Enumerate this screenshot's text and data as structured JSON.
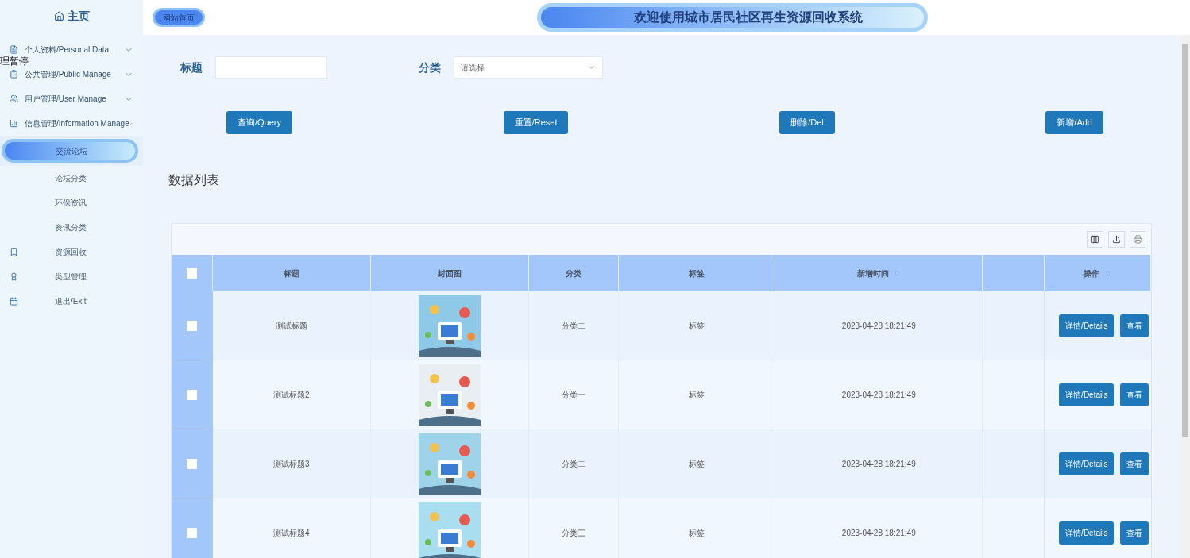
{
  "sidebar": {
    "home": "主页",
    "overlay_text": "理暂停",
    "groups": [
      {
        "label": "个人资料/Personal Data",
        "expanded": false
      },
      {
        "label": "公共管理/Public Manage",
        "expanded": false
      },
      {
        "label": "用户管理/User Manage",
        "expanded": false
      },
      {
        "label": "信息管理/Information Manage",
        "expanded": true,
        "children": [
          {
            "label": "交流论坛",
            "selected": true
          },
          {
            "label": "论坛分类",
            "selected": false
          },
          {
            "label": "环保资讯",
            "selected": false
          },
          {
            "label": "资讯分类",
            "selected": false
          }
        ]
      }
    ],
    "items": [
      {
        "label": "资源回收"
      },
      {
        "label": "类型管理"
      },
      {
        "label": "退出/Exit"
      }
    ]
  },
  "header": {
    "home_link": "网站首页",
    "title": "欢迎使用城市居民社区再生资源回收系统"
  },
  "search": {
    "fields": [
      {
        "label": "标题",
        "kind": "text"
      },
      {
        "label": "分类",
        "kind": "select",
        "placeholder": "请选择"
      }
    ],
    "buttons": [
      "查询/Query",
      "重置/Reset",
      "删除/Del",
      "新增/Add"
    ]
  },
  "list_title": "数据列表",
  "table": {
    "select_all_checked": false,
    "columns": [
      {
        "label": "标题",
        "sortable": false
      },
      {
        "label": "封面图",
        "sortable": false
      },
      {
        "label": "分类",
        "sortable": false
      },
      {
        "label": "标签",
        "sortable": false
      },
      {
        "label": "新增时间",
        "sortable": true
      },
      {
        "sortable": false
      },
      {
        "label": "操作",
        "sortable": true
      }
    ],
    "rows": [
      {
        "checked": false,
        "title": "测试标题",
        "image": {
          "kind": "picture"
        },
        "category": "分类二",
        "tag": "标签",
        "time": "2023-04-28 18:21:49",
        "actions": [
          "详情/Details",
          "查看"
        ]
      },
      {
        "checked": false,
        "title": "测试标题2",
        "image": {
          "kind": "picture"
        },
        "category": "分类一",
        "tag": "标签",
        "time": "2023-04-28 18:21:49",
        "actions": [
          "详情/Details",
          "查看"
        ]
      },
      {
        "checked": false,
        "title": "测试标题3",
        "image": {
          "kind": "picture"
        },
        "category": "分类二",
        "tag": "标签",
        "time": "2023-04-28 18:21:49",
        "actions": [
          "详情/Details",
          "查看"
        ]
      },
      {
        "checked": false,
        "title": "测试标题4",
        "image": {
          "kind": "picture"
        },
        "category": "分类三",
        "tag": "标签",
        "time": "2023-04-28 18:21:49",
        "actions": [
          "详情/Details",
          "查看"
        ]
      }
    ]
  }
}
